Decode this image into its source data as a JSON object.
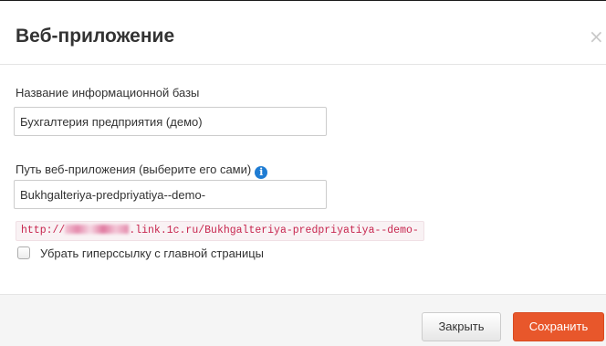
{
  "dialog": {
    "title": "Веб-приложение",
    "close_glyph": "×"
  },
  "form": {
    "db_name_label": "Название информационной базы",
    "db_name_value": "Бухгалтерия предприятия (демо)",
    "path_label": "Путь веб-приложения (выберите его сами)",
    "info_icon_glyph": "i",
    "path_value": "Bukhgalteriya-predpriyatiya--demo-",
    "url_prefix": "http://",
    "url_middle": ".link.1c.ru/",
    "url_suffix": "Bukhgalteriya-predpriyatiya--demo-",
    "hide_link_label": "Убрать гиперссылку с главной страницы",
    "hide_link_checked": false
  },
  "footer": {
    "close_label": "Закрыть",
    "save_label": "Сохранить"
  },
  "colors": {
    "save_button": "#e8572b",
    "info_icon": "#1f7cd3",
    "url_text": "#c7254e",
    "url_background": "#f9f2f4"
  },
  "icons": {
    "close": "close-icon",
    "info": "info-icon"
  }
}
